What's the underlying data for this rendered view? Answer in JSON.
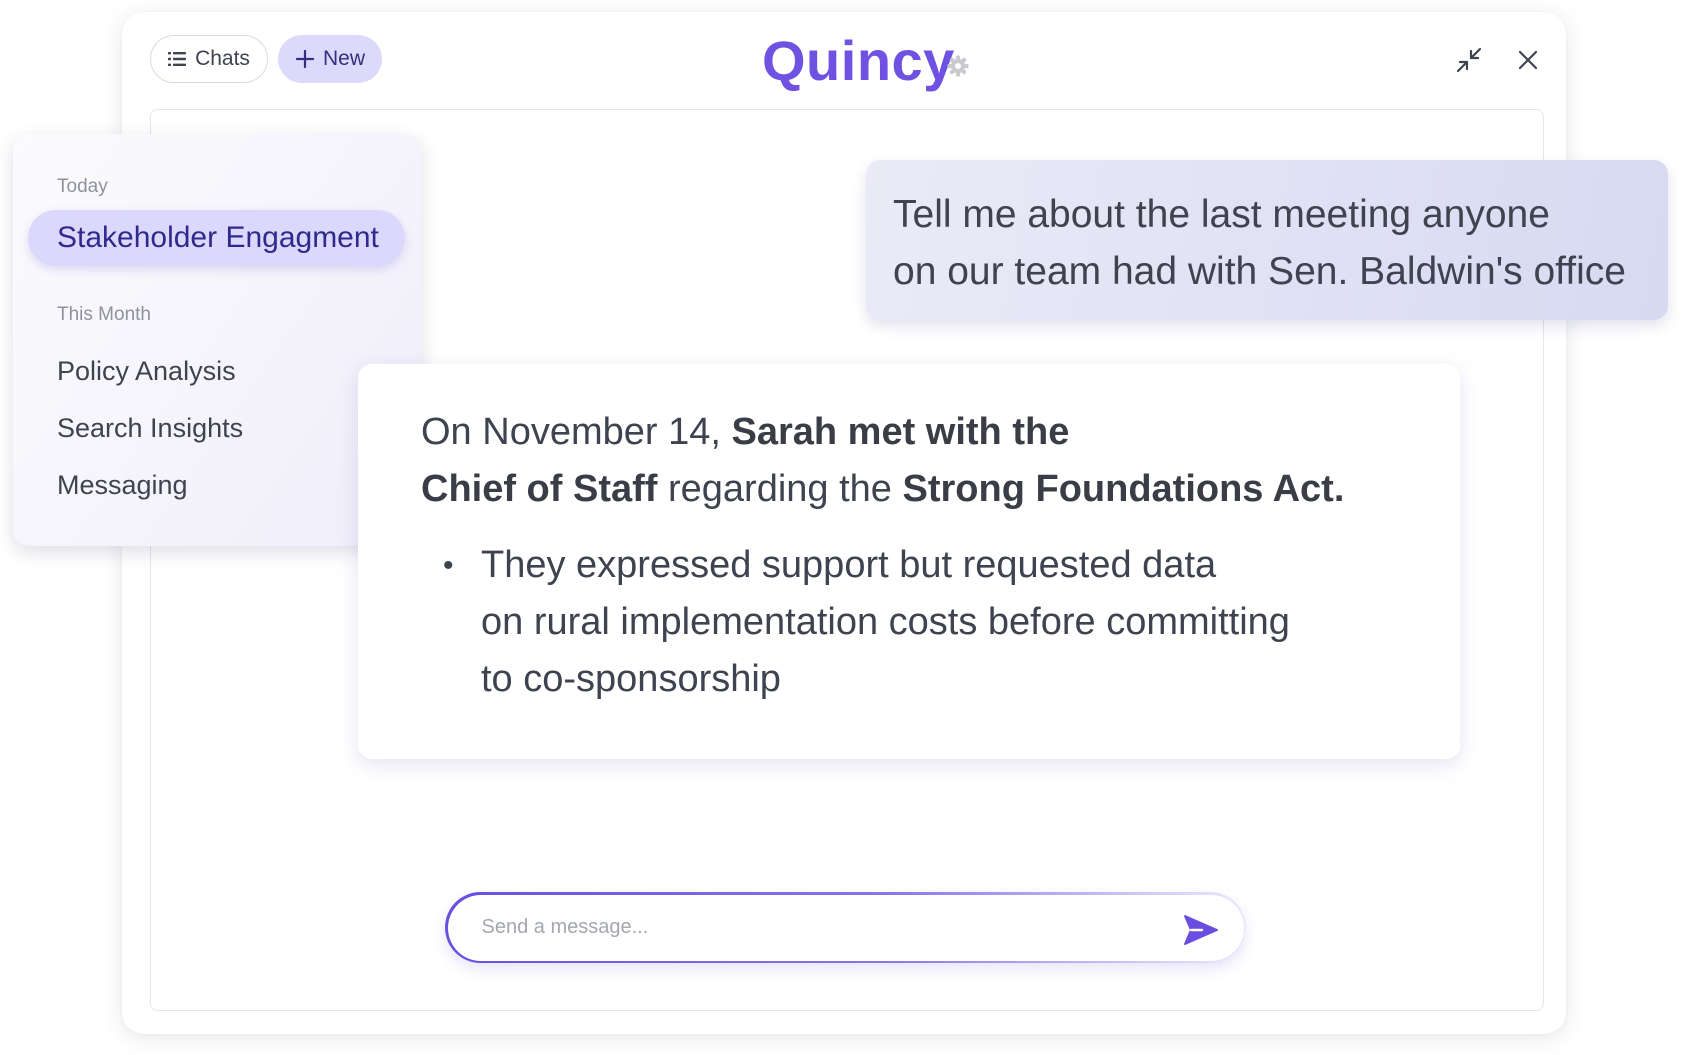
{
  "header": {
    "chats_label": "Chats",
    "new_label": "New",
    "brand": "Quincy"
  },
  "sidebar": {
    "sections": [
      {
        "title": "Today",
        "items": [
          {
            "label": "Stakeholder Engagment",
            "active": true
          }
        ]
      },
      {
        "title": "This Month",
        "items": [
          {
            "label": "Policy Analysis"
          },
          {
            "label": "Search Insights"
          },
          {
            "label": "Messaging"
          }
        ]
      }
    ]
  },
  "conversation": {
    "user_message": {
      "line1": "Tell me about the last meeting anyone",
      "line2": "on our team had with Sen. Baldwin's office"
    },
    "reply": {
      "p_date": "On November 14, ",
      "p_who": "Sarah met with the",
      "p_role": "Chief of Staff",
      "p_regarding": " regarding the ",
      "p_act": "Strong Foundations Act.",
      "bullets": [
        {
          "marker": "•",
          "line1": "They expressed support but requested data",
          "line2": "on rural implementation costs before committing",
          "line3": "to co-sponsorship"
        }
      ]
    }
  },
  "composer": {
    "placeholder": "Send a message...",
    "value": ""
  },
  "colors": {
    "accent": "#7052e3",
    "active_item_bg": "#dcd8fb",
    "new_button_bg": "#ddd9fb",
    "user_bubble_bg": "#dfe0f4"
  },
  "icons": {
    "chats": "list-icon",
    "new": "plus-icon",
    "settings": "gear-icon",
    "minimize": "minimize-icon",
    "close": "close-icon",
    "send": "send-icon"
  }
}
